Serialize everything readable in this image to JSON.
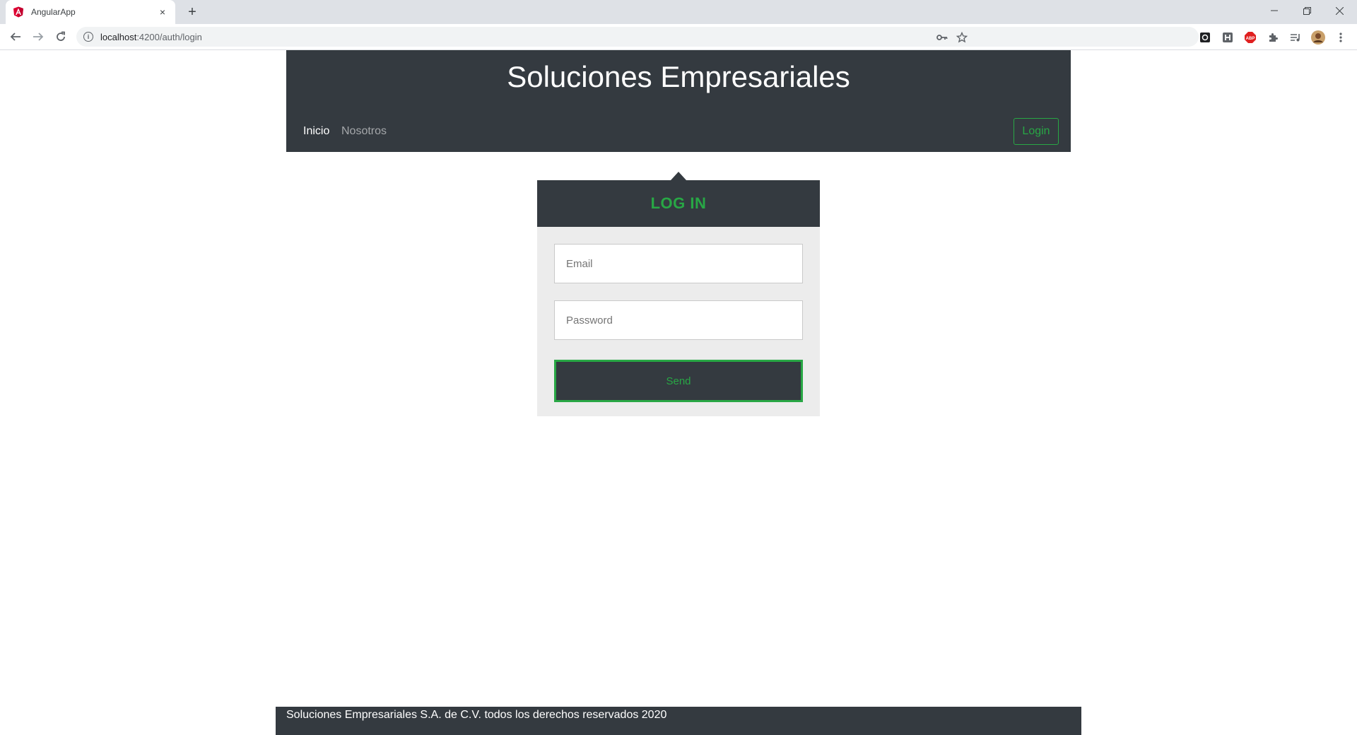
{
  "browser": {
    "tab_title": "AngularApp",
    "tab_close": "×",
    "new_tab": "+",
    "url_host": "localhost",
    "url_path": ":4200/auth/login",
    "icons": [
      "angular-favicon",
      "back-arrow-icon",
      "forward-arrow-icon",
      "reload-icon",
      "info-icon",
      "key-icon",
      "star-icon",
      "extension-icons",
      "puzzle-icon",
      "media-icon",
      "profile-avatar",
      "menu-dots-icon"
    ]
  },
  "header": {
    "title": "Soluciones Empresariales",
    "nav": [
      {
        "label": "Inicio",
        "active": true
      },
      {
        "label": "Nosotros",
        "active": false
      }
    ],
    "login_button": "Login"
  },
  "login_form": {
    "title": "LOG IN",
    "email_placeholder": "Email",
    "password_placeholder": "Password",
    "submit_label": "Send"
  },
  "footer": {
    "text": "Soluciones Empresariales S.A. de C.V. todos los derechos reservados 2020"
  },
  "colors": {
    "dark": "#343a40",
    "accent": "#28a745",
    "card_bg": "#ececec"
  }
}
